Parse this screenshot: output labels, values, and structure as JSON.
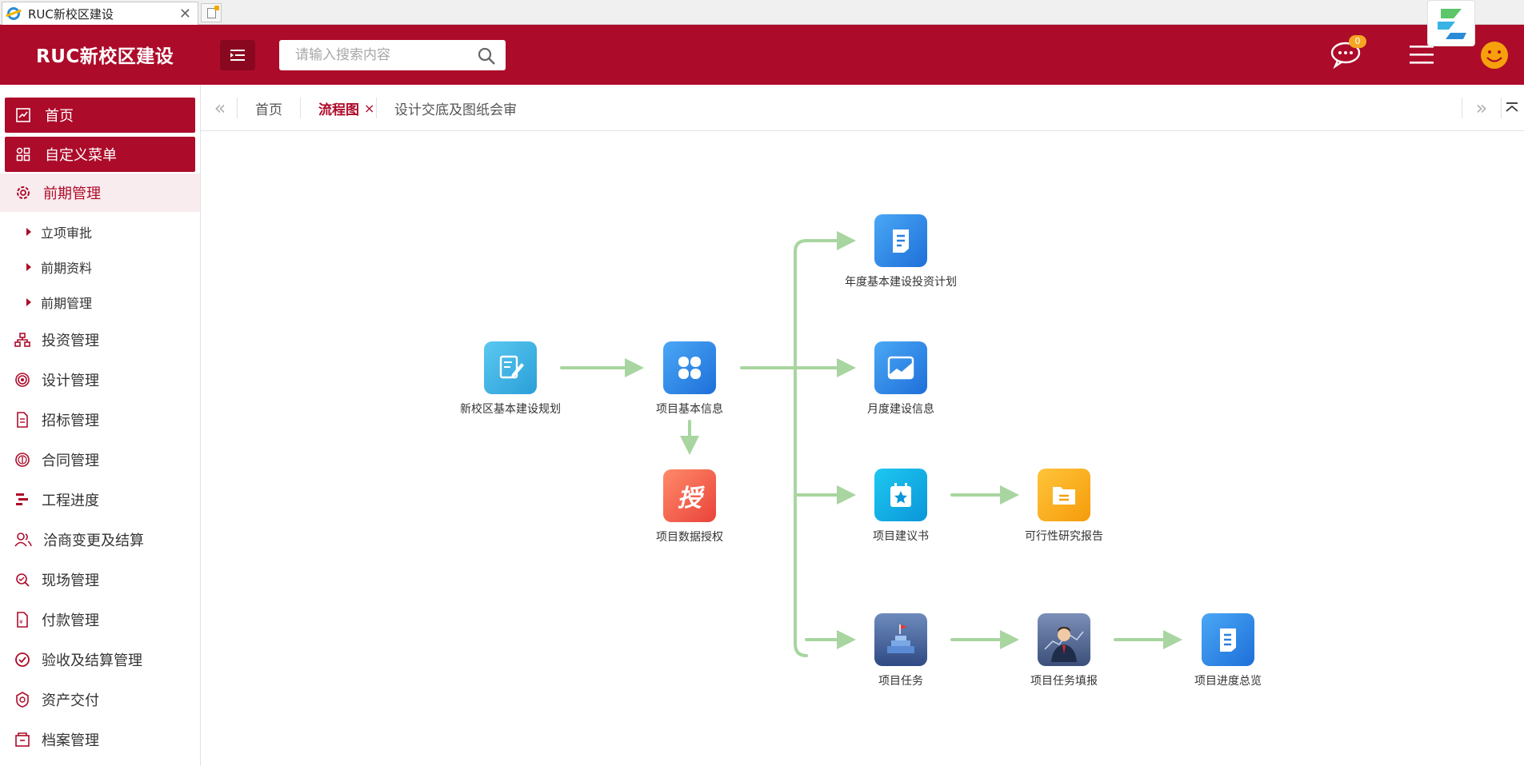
{
  "browser": {
    "tab_title": "RUC新校区建设",
    "close_glyph": "✕"
  },
  "header": {
    "logo": "RUC新校区建设",
    "search_placeholder": "请输入搜索内容",
    "message_count": "0",
    "brand_color": "#ad0b2a"
  },
  "sidebar": {
    "pinned": [
      {
        "label": "首页",
        "icon": "chart-line-icon"
      },
      {
        "label": "自定义菜单",
        "icon": "grid-icon"
      }
    ],
    "group": {
      "label": "前期管理",
      "icon": "gear-icon"
    },
    "sub_items": [
      "立项审批",
      "前期资料",
      "前期管理"
    ],
    "items": [
      {
        "label": "投资管理",
        "icon": "org-icon"
      },
      {
        "label": "设计管理",
        "icon": "target-icon"
      },
      {
        "label": "招标管理",
        "icon": "document-icon"
      },
      {
        "label": "合同管理",
        "icon": "coin-icon"
      },
      {
        "label": "工程进度",
        "icon": "gantt-icon"
      },
      {
        "label": "洽商变更及结算",
        "icon": "people-icon"
      },
      {
        "label": "现场管理",
        "icon": "inspect-icon"
      },
      {
        "label": "付款管理",
        "icon": "invoice-icon"
      },
      {
        "label": "验收及结算管理",
        "icon": "check-circle-icon"
      },
      {
        "label": "资产交付",
        "icon": "badge-icon"
      },
      {
        "label": "档案管理",
        "icon": "archive-icon"
      }
    ]
  },
  "content_tabs": {
    "tabs": [
      "首页",
      "流程图",
      "设计交底及图纸会审"
    ],
    "active": "流程图",
    "close_glyph": "×"
  },
  "flow": {
    "nodes": {
      "plan": "新校区基本建设规划",
      "info": "项目基本信息",
      "auth": "项目数据授权",
      "annual": "年度基本建设投资计划",
      "monthly": "月度建设信息",
      "proposal": "项目建议书",
      "feasibility": "可行性研究报告",
      "task": "项目任务",
      "task_fill": "项目任务填报",
      "progress": "项目进度总览"
    },
    "auth_glyph": "授",
    "arrow_color": "#a8d5a0"
  }
}
